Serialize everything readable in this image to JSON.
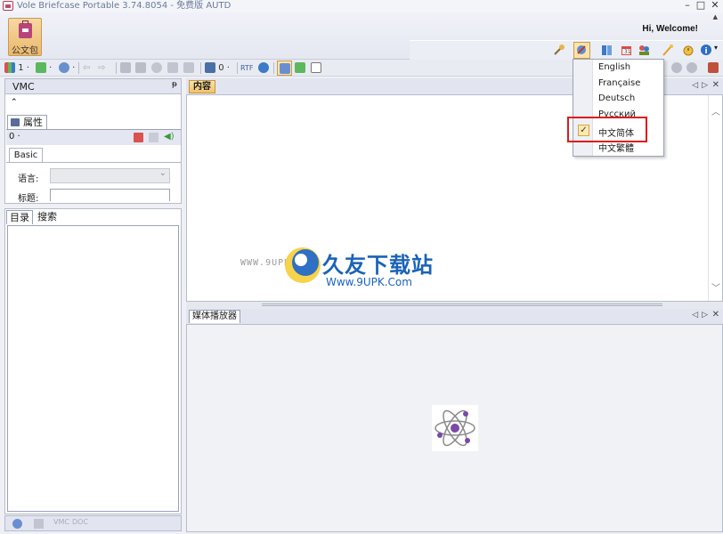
{
  "window": {
    "title": "Vole Briefcase Portable  3.74.8054 - 免费版 AUTD",
    "controls": [
      "–",
      "□",
      "✕"
    ]
  },
  "ribbon": {
    "welcome": "Hi, Welcome!",
    "briefcase_label": "公文包"
  },
  "toolbar": {
    "count_left": "1 ·",
    "count_mid": "0 ·"
  },
  "vmc_panel": {
    "title": "VMC",
    "properties_tab": "属性",
    "count": "0 ·",
    "basic_tab": "Basic",
    "language_label": "语言:",
    "title_label": "标题:"
  },
  "tree_panel": {
    "tabs": [
      "目录",
      "搜索"
    ]
  },
  "content_panel": {
    "tab": "内容"
  },
  "media_panel": {
    "tab": "媒体播放器"
  },
  "language_menu": {
    "items": [
      "English",
      "Française",
      "Deutsch",
      "Русский",
      "中文简体",
      "中文繁體"
    ],
    "selected": "中文简体"
  },
  "watermark": {
    "small_url": "WWW.9UPK.COM",
    "brand": "久友下载站",
    "url": "Www.9UPK.Com"
  },
  "colors": {
    "accent_tab": "#f1c26a",
    "highlight_box": "#e01818",
    "watermark_blue": "#1a63b8"
  }
}
